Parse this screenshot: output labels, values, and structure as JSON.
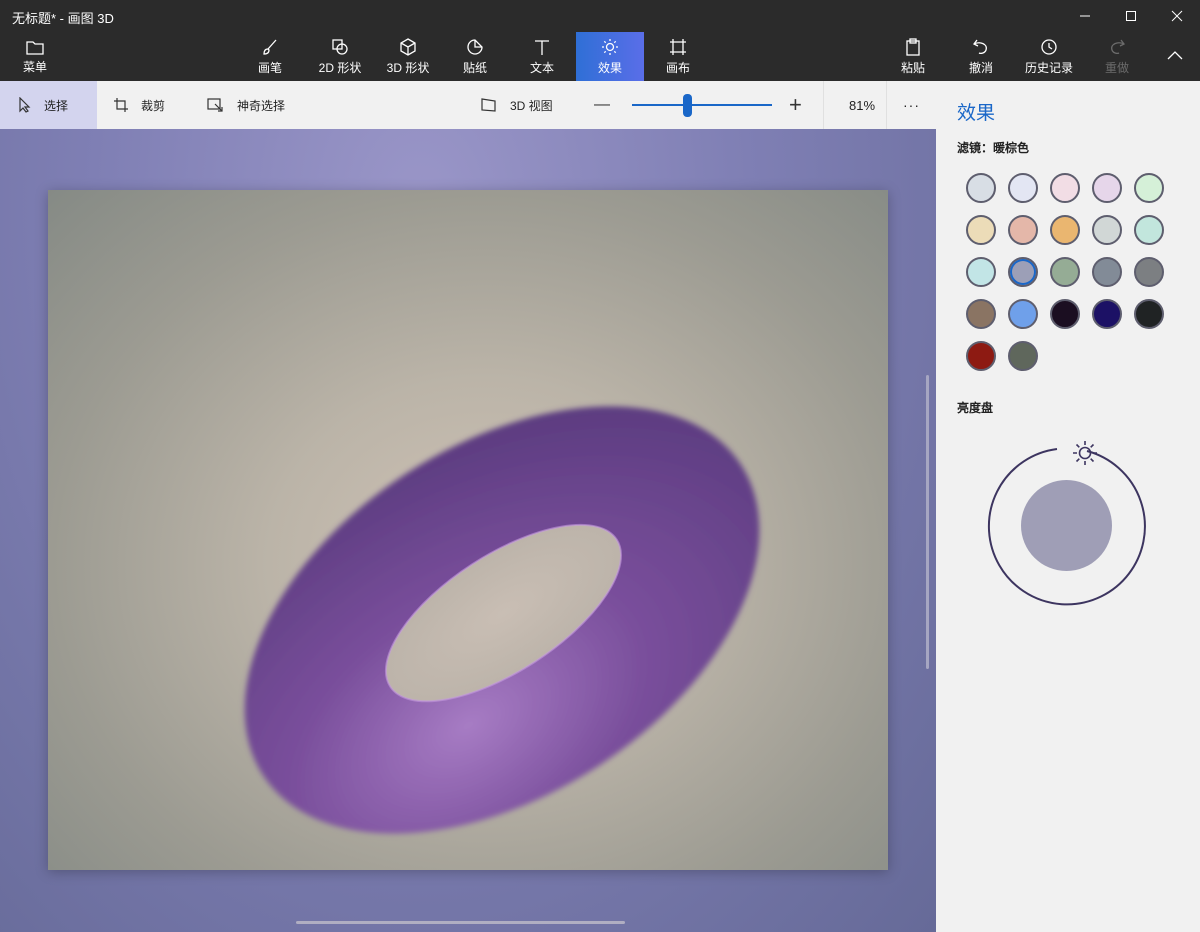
{
  "window": {
    "title": "无标题* - 画图 3D",
    "controls": [
      "minimize-icon",
      "maximize-icon",
      "close-icon"
    ]
  },
  "ribbon": {
    "menu_label": "菜单",
    "tools": [
      {
        "label": "画笔",
        "icon": "brush-icon"
      },
      {
        "label": "2D 形状",
        "icon": "shapes-2d-icon"
      },
      {
        "label": "3D 形状",
        "icon": "cube-icon"
      },
      {
        "label": "贴纸",
        "icon": "sticker-icon"
      },
      {
        "label": "文本",
        "icon": "text-icon"
      },
      {
        "label": "效果",
        "icon": "sun-icon",
        "active": true
      },
      {
        "label": "画布",
        "icon": "canvas-icon"
      }
    ],
    "right_actions": [
      {
        "label": "粘贴",
        "icon": "paste-icon"
      },
      {
        "label": "撤消",
        "icon": "undo-icon"
      },
      {
        "label": "历史记录",
        "icon": "history-icon"
      },
      {
        "label": "重做",
        "icon": "redo-icon",
        "disabled": true
      }
    ]
  },
  "toolbar": {
    "select_label": "选择",
    "crop_label": "裁剪",
    "magic_select_label": "神奇选择",
    "view3d_label": "3D 视图",
    "zoom_minus": "—",
    "zoom_plus": "+",
    "zoom_value": "81%",
    "more": "···"
  },
  "panel": {
    "title": "效果",
    "filter_label": "滤镜：暖棕色",
    "brightness_label": "亮度盘",
    "brightness_level": 0.55,
    "filters": [
      "#d8dee5",
      "#e3e6f3",
      "#f2dde5",
      "#e6d6ea",
      "#d5f0d8",
      "#ecdcb8",
      "#e4b7a9",
      "#eab670",
      "#d1d7d6",
      "#c2e6dd",
      "#c2e5e6",
      "#9c9fb7",
      "#95ac95",
      "#828b97",
      "#7c7f82",
      "#8a7463",
      "#6fa0ea",
      "#1b0e21",
      "#1c1165",
      "#202324",
      "#8d1a12",
      "#5f675c"
    ],
    "selected_filter_index": 11
  },
  "colors": {
    "accent": "#1a67c8",
    "torus": "#6b4a8c"
  }
}
